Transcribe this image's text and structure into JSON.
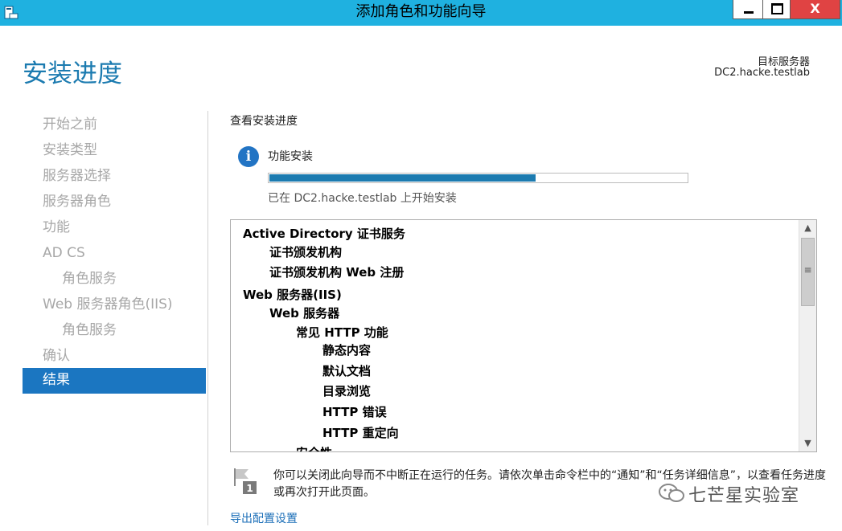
{
  "window": {
    "title": "添加角色和功能向导",
    "close_label": "X"
  },
  "header": {
    "page_title": "安装进度",
    "target_label": "目标服务器",
    "target_server": "DC2.hacke.testlab"
  },
  "sidebar": {
    "items": [
      {
        "label": "开始之前"
      },
      {
        "label": "安装类型"
      },
      {
        "label": "服务器选择"
      },
      {
        "label": "服务器角色"
      },
      {
        "label": "功能"
      },
      {
        "label": "AD CS"
      },
      {
        "label": "角色服务"
      },
      {
        "label": "Web 服务器角色(IIS)"
      },
      {
        "label": "角色服务"
      },
      {
        "label": "确认"
      },
      {
        "label": "结果"
      }
    ],
    "active_index": 10
  },
  "main": {
    "section_title": "查看安装进度",
    "feature_label": "功能安装",
    "progress_fraction": 0.64,
    "progress_status": "已在 DC2.hacke.testlab 上开始安装",
    "tree_items": [
      {
        "label": "Active Directory 证书服务",
        "level": 0
      },
      {
        "label": "证书颁发机构",
        "level": 1
      },
      {
        "label": "证书颁发机构 Web 注册",
        "level": 1
      },
      {
        "label": "Web 服务器(IIS)",
        "level": 0
      },
      {
        "label": "Web 服务器",
        "level": 1
      },
      {
        "label": "常见 HTTP 功能",
        "level": 2
      },
      {
        "label": "静态内容",
        "level": 3
      },
      {
        "label": "默认文档",
        "level": 3
      },
      {
        "label": "目录浏览",
        "level": 3
      },
      {
        "label": "HTTP 错误",
        "level": 3
      },
      {
        "label": "HTTP 重定向",
        "level": 3
      },
      {
        "label": "安全性",
        "level": 2
      }
    ],
    "note_text": "你可以关闭此向导而不中断正在运行的任务。请依次单击命令栏中的“通知”和“任务详细信息”，以查看任务进度或再次打开此页面。",
    "export_link": "导出配置设置"
  },
  "watermark": {
    "text": "七芒星实验室"
  },
  "colors": {
    "titlebar": "#1fb1e0",
    "accent": "#1c7bb0",
    "nav_active": "#1b76c1",
    "close_button": "#e04343"
  },
  "icons": {
    "app": "server-manager-icon",
    "info": "info-icon",
    "note": "flag-notification-icon",
    "watermark": "wechat-icon"
  }
}
